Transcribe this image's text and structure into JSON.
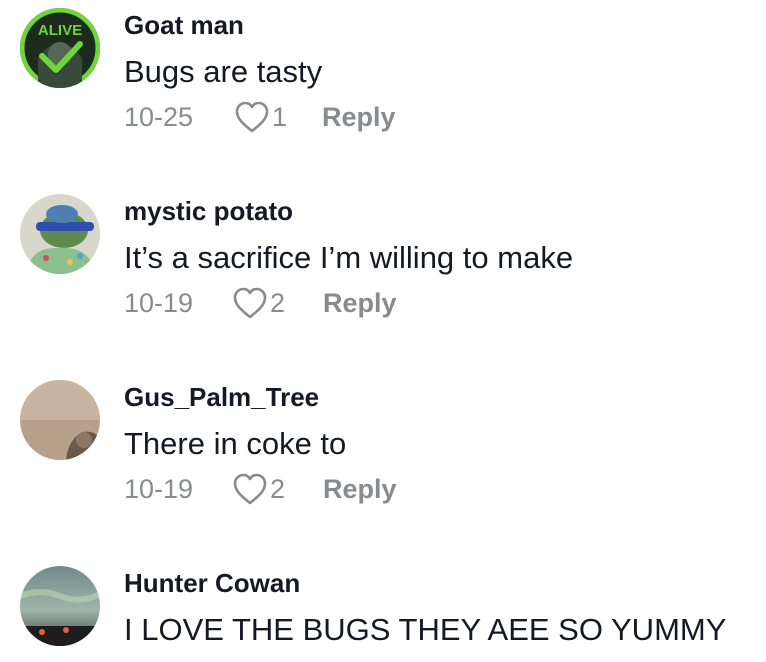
{
  "comments": [
    {
      "username": "Goat man",
      "text": "Bugs are tasty",
      "date": "10-25",
      "likes": "1",
      "reply_label": "Reply",
      "avatar_badge": "ALIVE",
      "avatar_icon": "checkmark-icon"
    },
    {
      "username": "mystic potato",
      "text": "It’s a sacrifice I’m willing to make",
      "date": "10-19",
      "likes": "2",
      "reply_label": "Reply"
    },
    {
      "username": "Gus_Palm_Tree",
      "text": "There in coke to",
      "date": "10-19",
      "likes": "2",
      "reply_label": "Reply"
    },
    {
      "username": "Hunter Cowan",
      "text": "I LOVE THE BUGS THEY AEE SO YUMMY"
    }
  ],
  "icons": {
    "like": "heart-outline-icon"
  },
  "colors": {
    "text_primary": "#161823",
    "text_secondary": "#8a8b91",
    "background": "#ffffff",
    "alive_badge_green": "#6fd63a"
  }
}
